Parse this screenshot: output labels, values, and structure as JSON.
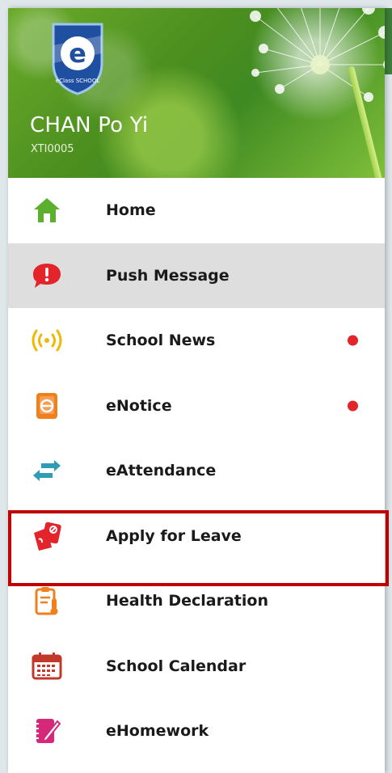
{
  "user": {
    "name": "CHAN Po Yi",
    "id": "XTI0005"
  },
  "logo": {
    "letter": "e",
    "text": "eClass SCHOOL"
  },
  "menu": {
    "items": [
      {
        "label": "Home",
        "icon": "home-icon",
        "color": "#5cb02c",
        "badge": false,
        "active": false
      },
      {
        "label": "Push Message",
        "icon": "push-message-icon",
        "color": "#e3242b",
        "badge": false,
        "active": true
      },
      {
        "label": "School News",
        "icon": "broadcast-icon",
        "color": "#f2b705",
        "badge": true,
        "active": false
      },
      {
        "label": "eNotice",
        "icon": "notice-icon",
        "color": "#f07f1e",
        "badge": true,
        "active": false
      },
      {
        "label": "eAttendance",
        "icon": "swap-arrows-icon",
        "color": "#2f9cb5",
        "badge": false,
        "active": false
      },
      {
        "label": "Apply for Leave",
        "icon": "leave-icon",
        "color": "#e3242b",
        "badge": false,
        "active": false,
        "highlighted": true
      },
      {
        "label": "Health Declaration",
        "icon": "health-clipboard-icon",
        "color": "#f07f1e",
        "badge": false,
        "active": false
      },
      {
        "label": "School Calendar",
        "icon": "calendar-icon",
        "color": "#c0392b",
        "badge": false,
        "active": false
      },
      {
        "label": "eHomework",
        "icon": "homework-icon",
        "color": "#d6287a",
        "badge": false,
        "active": false
      }
    ]
  },
  "colors": {
    "badge": "#e3242b",
    "active_row": "#dedede",
    "highlight_border": "#c00000"
  }
}
